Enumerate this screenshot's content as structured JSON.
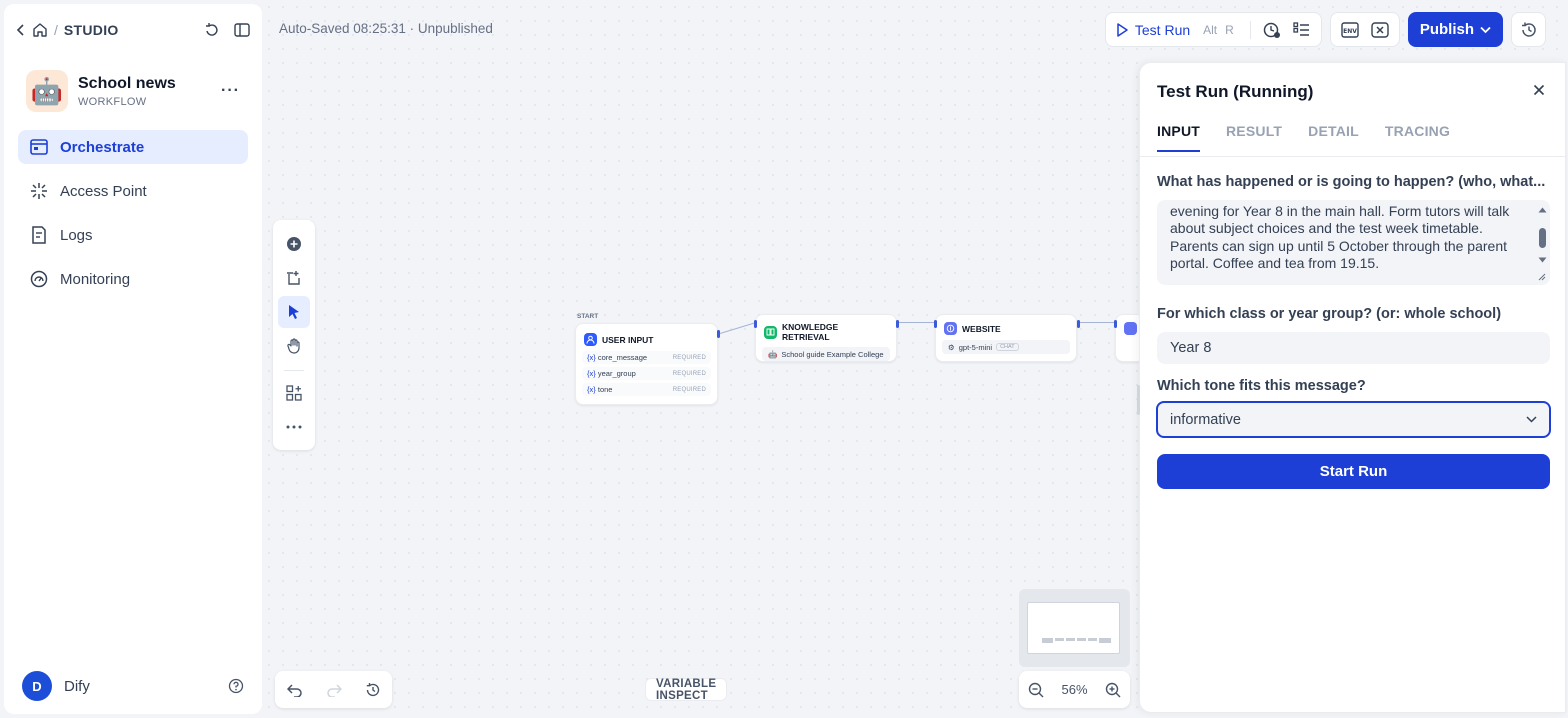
{
  "sidebar": {
    "breadcrumb_title": "STUDIO",
    "app": {
      "name": "School news",
      "type": "WORKFLOW",
      "icon": "robot-emoji"
    },
    "nav": [
      {
        "label": "Orchestrate",
        "icon": "orchestrate-icon",
        "active": true
      },
      {
        "label": "Access Point",
        "icon": "access-point-icon",
        "active": false
      },
      {
        "label": "Logs",
        "icon": "logs-icon",
        "active": false
      },
      {
        "label": "Monitoring",
        "icon": "monitoring-icon",
        "active": false
      }
    ],
    "user": {
      "initial": "D",
      "name": "Dify"
    }
  },
  "header": {
    "status": "Auto-Saved 08:25:31 · Unpublished",
    "test_run_label": "Test Run",
    "shortcut_alt": "Alt",
    "shortcut_key": "R",
    "publish_label": "Publish"
  },
  "workflow": {
    "start_label": "START",
    "nodes": {
      "user_input": {
        "title": "USER INPUT",
        "vars": [
          {
            "prefix": "{x}",
            "name": "core_message",
            "req": "REQUIRED"
          },
          {
            "prefix": "{x}",
            "name": "year_group",
            "req": "REQUIRED"
          },
          {
            "prefix": "{x}",
            "name": "tone",
            "req": "REQUIRED"
          }
        ]
      },
      "knowledge": {
        "title": "KNOWLEDGE RETRIEVAL",
        "detail": "School guide Example College"
      },
      "website": {
        "title": "WEBSITE",
        "model": "gpt-5-mini",
        "chip": "CHAT"
      }
    },
    "variable_inspect": "VARIABLE INSPECT",
    "zoom": "56%"
  },
  "panel": {
    "title": "Test Run (Running)",
    "tabs": [
      "INPUT",
      "RESULT",
      "DETAIL",
      "TRACING"
    ],
    "active_tab": "INPUT",
    "fields": {
      "q1_label": "What has happened or is going to happen? (who, what...",
      "q1_value": "evening for Year 8 in the main hall. Form tutors will talk about subject choices and the test week timetable. Parents can sign up until 5 October through the parent portal. Coffee and tea from 19.15.",
      "q2_label": "For which class or year group? (or: whole school)",
      "q2_value": "Year 8",
      "q3_label": "Which tone fits this message?",
      "q3_value": "informative"
    },
    "start_run_label": "Start Run"
  },
  "colors": {
    "accent": "#1d3fd6",
    "active_nav_bg": "#e5edff",
    "knowledge_badge": "#12b76a",
    "llm_badge": "#6172f3",
    "start_badge": "#2e5bff"
  }
}
